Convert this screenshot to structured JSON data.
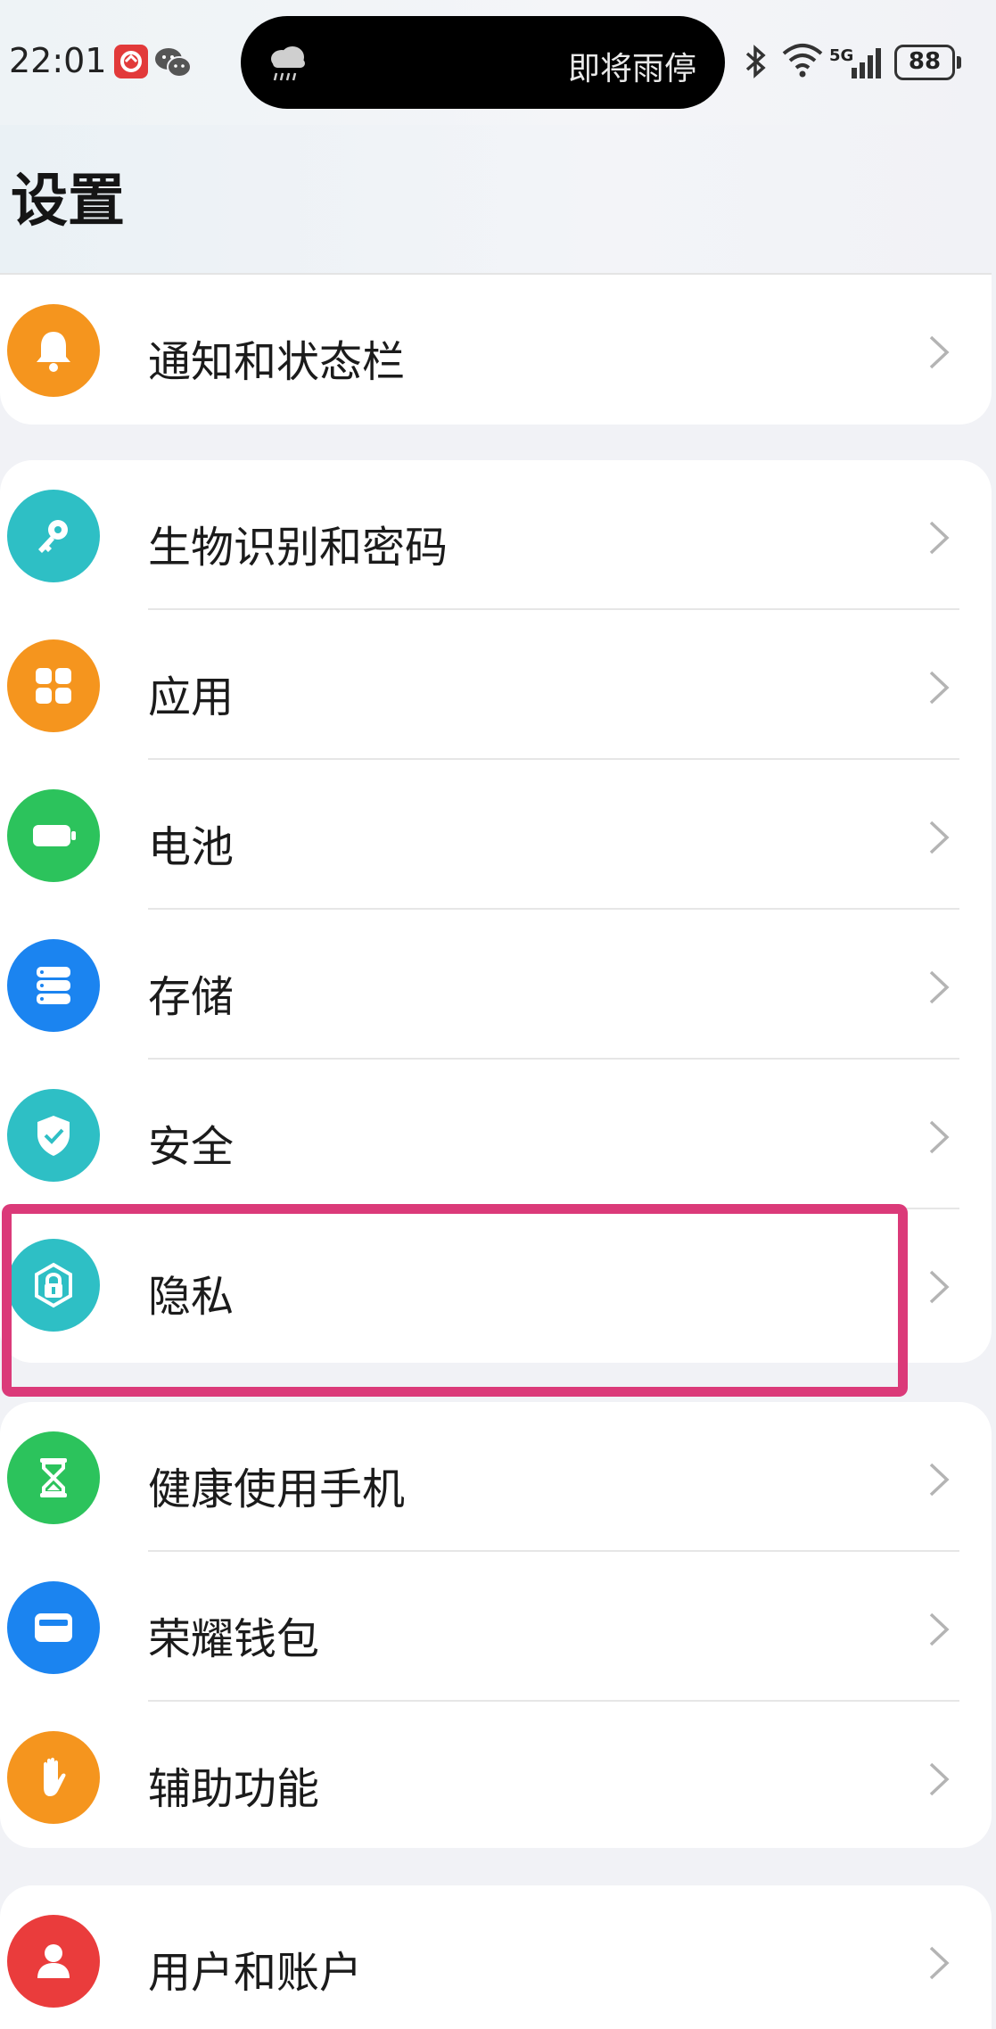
{
  "status_bar": {
    "time": "22:01",
    "island_text": "即将雨停",
    "network": "5G",
    "battery": "88"
  },
  "header": {
    "title": "设置"
  },
  "group_a": [
    {
      "label": "通知和状态栏",
      "icon": "bell-icon",
      "color": "#f5951e"
    }
  ],
  "group_b": [
    {
      "label": "生物识别和密码",
      "icon": "key-icon",
      "color": "#2ebfc5"
    },
    {
      "label": "应用",
      "icon": "apps-grid-icon",
      "color": "#f5951e"
    },
    {
      "label": "电池",
      "icon": "battery-icon",
      "color": "#2cc35c"
    },
    {
      "label": "存储",
      "icon": "storage-icon",
      "color": "#1b84f0"
    },
    {
      "label": "安全",
      "icon": "shield-check-icon",
      "color": "#2ebfc5"
    },
    {
      "label": "隐私",
      "icon": "privacy-lock-icon",
      "color": "#2ebfc5"
    }
  ],
  "group_c": [
    {
      "label": "健康使用手机",
      "icon": "hourglass-icon",
      "color": "#2cc35c"
    },
    {
      "label": "荣耀钱包",
      "icon": "wallet-icon",
      "color": "#1b84f0"
    },
    {
      "label": "辅助功能",
      "icon": "hand-icon",
      "color": "#f5951e"
    }
  ],
  "group_d": [
    {
      "label": "用户和账户",
      "icon": "user-icon",
      "color": "#ea3c3c"
    }
  ],
  "colors": {
    "highlight": "#db3a79",
    "background": "#f1f2f6"
  }
}
